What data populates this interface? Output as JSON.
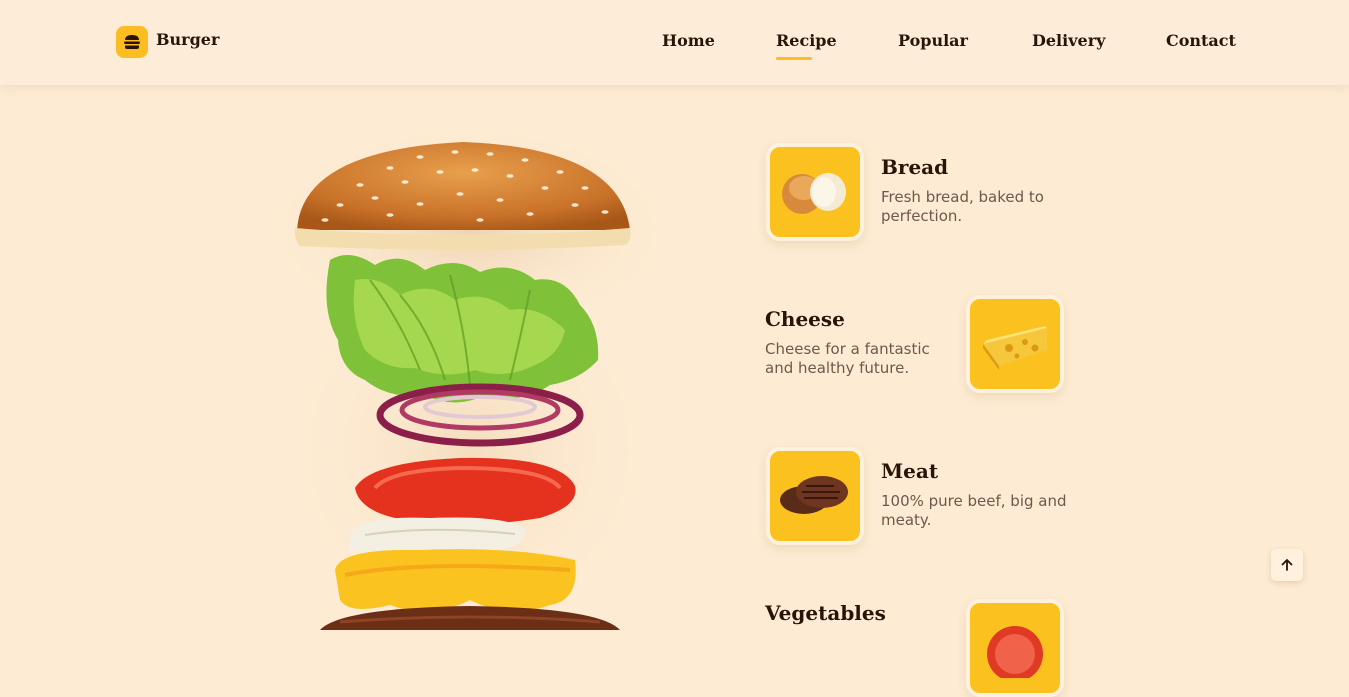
{
  "header": {
    "logo_text": "Burger",
    "nav": [
      {
        "label": "Home",
        "active": false
      },
      {
        "label": "Recipe",
        "active": true
      },
      {
        "label": "Popular",
        "active": false
      },
      {
        "label": "Delivery",
        "active": false
      },
      {
        "label": "Contact",
        "active": false
      }
    ]
  },
  "ingredients": [
    {
      "title": "Bread",
      "description": "Fresh bread, baked to perfection.",
      "icon": "bread-icon"
    },
    {
      "title": "Cheese",
      "description": "Cheese for a fantastic and healthy future.",
      "icon": "cheese-icon"
    },
    {
      "title": "Meat",
      "description": "100% pure beef, big and meaty.",
      "icon": "meat-icon"
    },
    {
      "title": "Vegetables",
      "description": "",
      "icon": "tomato-icon"
    }
  ],
  "scroll_up_icon": "arrow-up-icon",
  "colors": {
    "accent": "#fcbd22",
    "background": "#fdebd3",
    "text": "#2a1408"
  }
}
